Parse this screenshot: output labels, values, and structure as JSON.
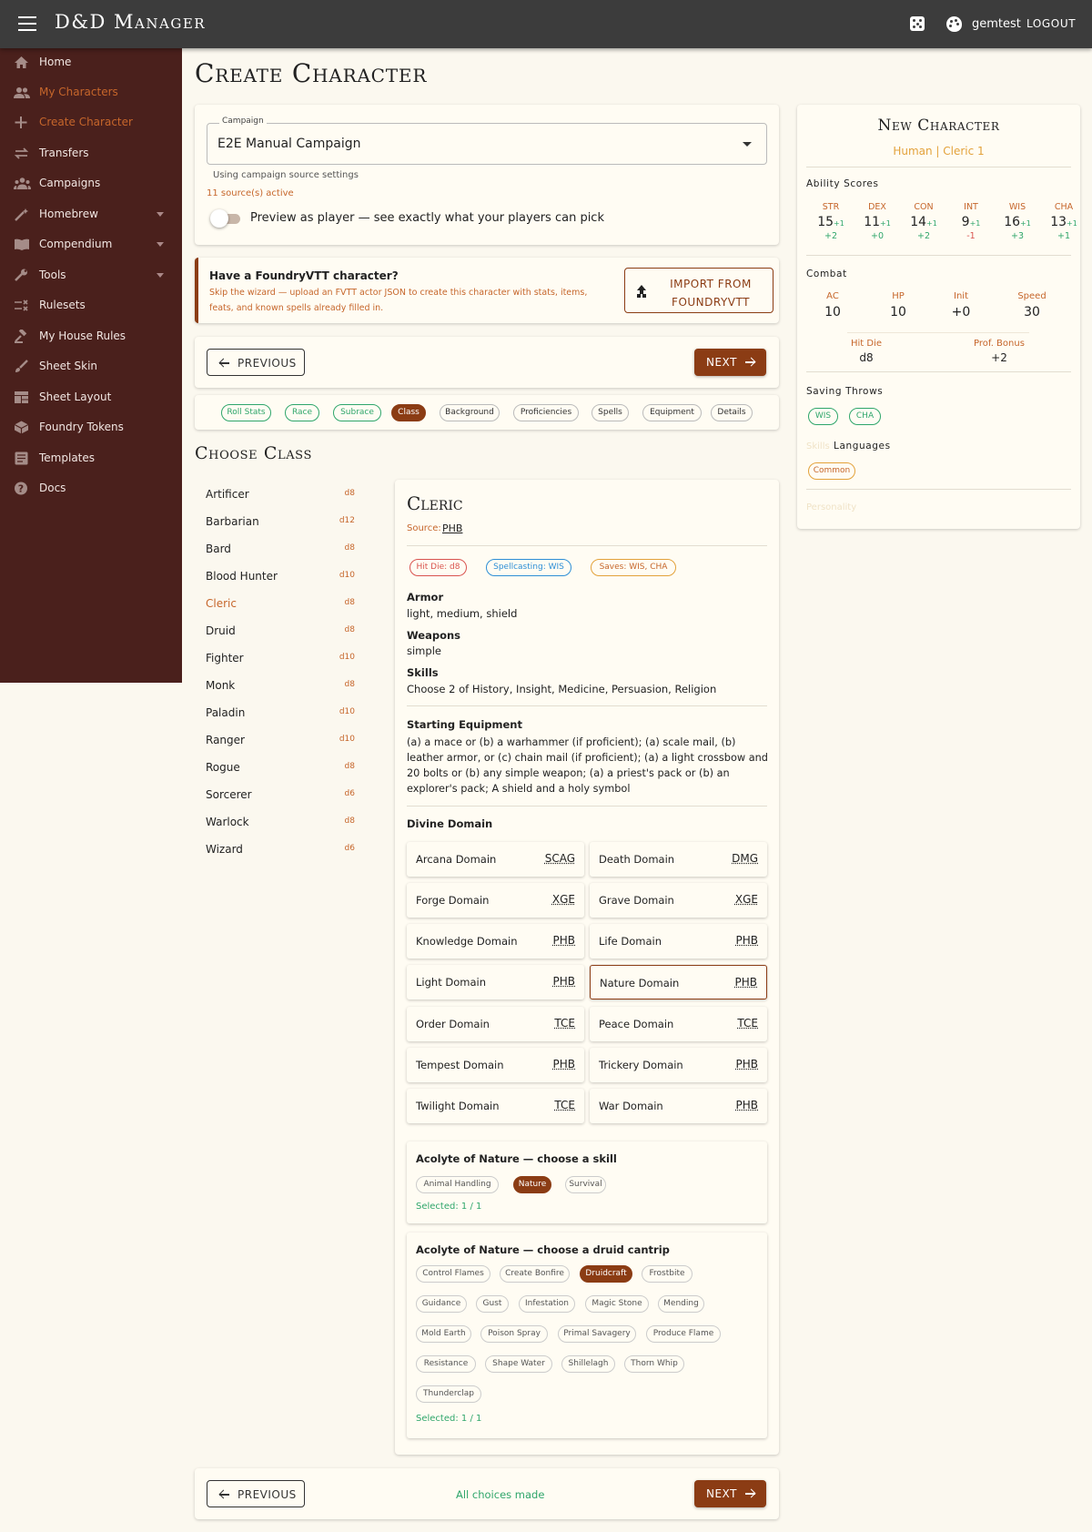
{
  "app": {
    "title": "D&D Manager",
    "user": "gemtest",
    "logout": "LOGOUT"
  },
  "sidebar": {
    "items": [
      {
        "label": "Home",
        "icon": "home-icon"
      },
      {
        "label": "My Characters",
        "icon": "people-icon"
      },
      {
        "label": "Create Character",
        "icon": "plus-icon"
      },
      {
        "label": "Transfers",
        "icon": "swap-icon"
      },
      {
        "label": "Campaigns",
        "icon": "groups-icon"
      },
      {
        "label": "Homebrew",
        "icon": "wand-icon"
      },
      {
        "label": "Compendium",
        "icon": "book-icon"
      },
      {
        "label": "Tools",
        "icon": "wrench-icon"
      },
      {
        "label": "Rulesets",
        "icon": "rules-icon"
      },
      {
        "label": "My House Rules",
        "icon": "gavel-icon"
      },
      {
        "label": "Sheet Skin",
        "icon": "brush-icon"
      },
      {
        "label": "Sheet Layout",
        "icon": "grid-icon"
      },
      {
        "label": "Foundry Tokens",
        "icon": "token-icon"
      },
      {
        "label": "Templates",
        "icon": "template-icon"
      },
      {
        "label": "Docs",
        "icon": "help-icon"
      }
    ]
  },
  "page": {
    "title": "Create Character"
  },
  "campaign": {
    "label": "Campaign",
    "value": "E2E Manual Campaign",
    "helper": "Using campaign source settings",
    "sources_active": "11 source(s) active",
    "preview_label": "Preview as player — see exactly what your players can pick"
  },
  "foundry": {
    "title": "Have a FoundryVTT character?",
    "desc": "Skip the wizard — upload an FVTT actor JSON to create this character with stats, items, feats, and known spells already filled in.",
    "import_label": "IMPORT FROM FOUNDRYVTT"
  },
  "nav": {
    "previous": "PREVIOUS",
    "next": "NEXT",
    "status": "All choices made"
  },
  "steps": [
    "Roll Stats",
    "Race",
    "Subrace",
    "Class",
    "Background",
    "Proficiencies",
    "Spells",
    "Equipment",
    "Details"
  ],
  "choose_class": {
    "title": "Choose Class",
    "classes": [
      {
        "name": "Artificer",
        "die": "d8"
      },
      {
        "name": "Barbarian",
        "die": "d12"
      },
      {
        "name": "Bard",
        "die": "d8"
      },
      {
        "name": "Blood Hunter",
        "die": "d10"
      },
      {
        "name": "Cleric",
        "die": "d8"
      },
      {
        "name": "Druid",
        "die": "d8"
      },
      {
        "name": "Fighter",
        "die": "d10"
      },
      {
        "name": "Monk",
        "die": "d8"
      },
      {
        "name": "Paladin",
        "die": "d10"
      },
      {
        "name": "Ranger",
        "die": "d10"
      },
      {
        "name": "Rogue",
        "die": "d8"
      },
      {
        "name": "Sorcerer",
        "die": "d6"
      },
      {
        "name": "Warlock",
        "die": "d8"
      },
      {
        "name": "Wizard",
        "die": "d6"
      }
    ]
  },
  "detail": {
    "title": "Cleric",
    "source_label": "Source:",
    "source": "PHB",
    "hit_die": "Hit Die: d8",
    "spellcasting": "Spellcasting: WIS",
    "saves": "Saves: WIS, CHA",
    "armor_label": "Armor",
    "armor": "light, medium, shield",
    "weapons_label": "Weapons",
    "weapons": "simple",
    "skills_label": "Skills",
    "skills": "Choose 2 of History, Insight, Medicine, Persuasion, Religion",
    "equipment_label": "Starting Equipment",
    "equipment": "(a) a mace or (b) a warhammer (if proficient); (a) scale mail, (b) leather armor, or (c) chain mail (if proficient); (a) a light crossbow and 20 bolts or (b) any simple weapon; (a) a priest's pack or (b) an explorer's pack; A shield and a holy symbol",
    "domain_label": "Divine Domain",
    "domains": [
      {
        "name": "Arcana Domain",
        "src": "SCAG"
      },
      {
        "name": "Death Domain",
        "src": "DMG"
      },
      {
        "name": "Forge Domain",
        "src": "XGE"
      },
      {
        "name": "Grave Domain",
        "src": "XGE"
      },
      {
        "name": "Knowledge Domain",
        "src": "PHB"
      },
      {
        "name": "Life Domain",
        "src": "PHB"
      },
      {
        "name": "Light Domain",
        "src": "PHB"
      },
      {
        "name": "Nature Domain",
        "src": "PHB"
      },
      {
        "name": "Order Domain",
        "src": "TCE"
      },
      {
        "name": "Peace Domain",
        "src": "TCE"
      },
      {
        "name": "Tempest Domain",
        "src": "PHB"
      },
      {
        "name": "Trickery Domain",
        "src": "PHB"
      },
      {
        "name": "Twilight Domain",
        "src": "TCE"
      },
      {
        "name": "War Domain",
        "src": "PHB"
      }
    ],
    "skill_choice": {
      "title": "Acolyte of Nature — choose a skill",
      "options": [
        "Animal Handling",
        "Nature",
        "Survival"
      ],
      "selected": "Selected: 1 / 1"
    },
    "cantrip_choice": {
      "title": "Acolyte of Nature — choose a druid cantrip",
      "options": [
        "Control Flames",
        "Create Bonfire",
        "Druidcraft",
        "Frostbite",
        "Guidance",
        "Gust",
        "Infestation",
        "Magic Stone",
        "Mending",
        "Mold Earth",
        "Poison Spray",
        "Primal Savagery",
        "Produce Flame",
        "Resistance",
        "Shape Water",
        "Shillelagh",
        "Thorn Whip",
        "Thunderclap"
      ],
      "selected": "Selected: 1 / 1"
    }
  },
  "summary": {
    "title": "New Character",
    "subtitle": "Human | Cleric 1",
    "ability_label": "Ability Scores",
    "abilities": [
      {
        "name": "STR",
        "score": "15",
        "bonus": "+1",
        "mod": "+2"
      },
      {
        "name": "DEX",
        "score": "11",
        "bonus": "+1",
        "mod": "+0"
      },
      {
        "name": "CON",
        "score": "14",
        "bonus": "+1",
        "mod": "+2"
      },
      {
        "name": "INT",
        "score": "9",
        "bonus": "+1",
        "mod": "-1"
      },
      {
        "name": "WIS",
        "score": "16",
        "bonus": "+1",
        "mod": "+3"
      },
      {
        "name": "CHA",
        "score": "13",
        "bonus": "+1",
        "mod": "+1"
      }
    ],
    "combat_label": "Combat",
    "combat": [
      {
        "name": "AC",
        "value": "10"
      },
      {
        "name": "HP",
        "value": "10"
      },
      {
        "name": "Init",
        "value": "+0"
      },
      {
        "name": "Speed",
        "value": "30"
      }
    ],
    "hit_die_label": "Hit Die",
    "hit_die": "d8",
    "prof_label": "Prof. Bonus",
    "prof": "+2",
    "saving_label": "Saving Throws",
    "saves": [
      "WIS",
      "CHA"
    ],
    "skills_label": "Skills",
    "languages_label": "Languages",
    "languages": [
      "Common"
    ],
    "personality_label": "Personality"
  },
  "colors": {
    "accent": "#8b3c14",
    "sidebar": "#4a201c",
    "topbar": "#3c3c3c",
    "success": "#2fa66b",
    "orange": "#c6662b"
  }
}
